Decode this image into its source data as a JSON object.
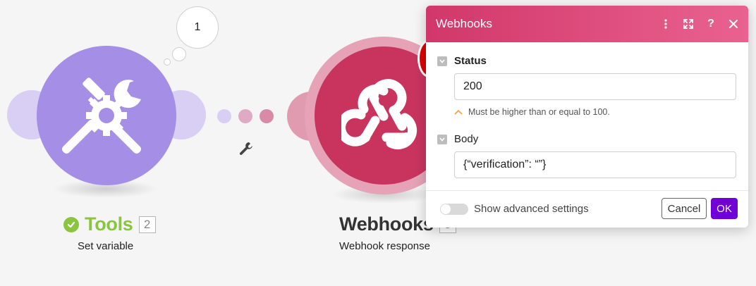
{
  "scenario": {
    "operations_bubble": "1",
    "modules": [
      {
        "title": "Tools",
        "number": "2",
        "subtitle": "Set variable",
        "icon": "tools-wrench-screwdriver-gear-icon",
        "color": "#a58ee6",
        "status": "success"
      },
      {
        "title": "Webhooks",
        "number": "3",
        "subtitle": "Webhook response",
        "icon": "webhook-icon",
        "color": "#c9345f"
      }
    ],
    "connector_icon": "wrench-icon"
  },
  "dialog": {
    "title": "Webhooks",
    "header_icons": [
      "more-vertical-icon",
      "expand-icon",
      "help-icon",
      "close-icon"
    ],
    "fields": {
      "status": {
        "label": "Status",
        "value": "200",
        "hint": "Must be higher than or equal to 100."
      },
      "body": {
        "label": "Body",
        "value": "{“verification”: “”}"
      }
    },
    "advanced_toggle_label": "Show advanced settings",
    "cancel_label": "Cancel",
    "ok_label": "OK"
  },
  "colors": {
    "tools": "#a58ee6",
    "webhooks": "#c9345f",
    "header_gradient_start": "#d1376a",
    "header_gradient_end": "#e9628f",
    "ok_button": "#7000d6",
    "success": "#8ac53f"
  }
}
